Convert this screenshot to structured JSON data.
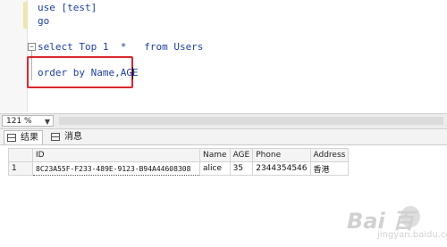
{
  "editor": {
    "lines": [
      "use [test]",
      "go",
      "select Top 1  *   from Users",
      "order by Name,AGE"
    ],
    "collapse_glyph": "−"
  },
  "status": {
    "zoom": "121 %"
  },
  "tabs": [
    {
      "label": "结果",
      "active": true
    },
    {
      "label": "消息",
      "active": false
    }
  ],
  "grid": {
    "columns": [
      "",
      "ID",
      "Name",
      "AGE",
      "Phone",
      "Address"
    ],
    "rows": [
      {
        "row_number": "1",
        "cells": [
          "8C23A55F-F233-489E-9123-B94A44608308",
          "alice",
          "35",
          "2344354546",
          "香港"
        ]
      }
    ]
  },
  "watermark": {
    "logo": "Bai 百",
    "sub": "jingyan.baidu.com"
  },
  "colors": {
    "keyword": "#1f3f9e",
    "highlight_border": "#d9272e"
  }
}
